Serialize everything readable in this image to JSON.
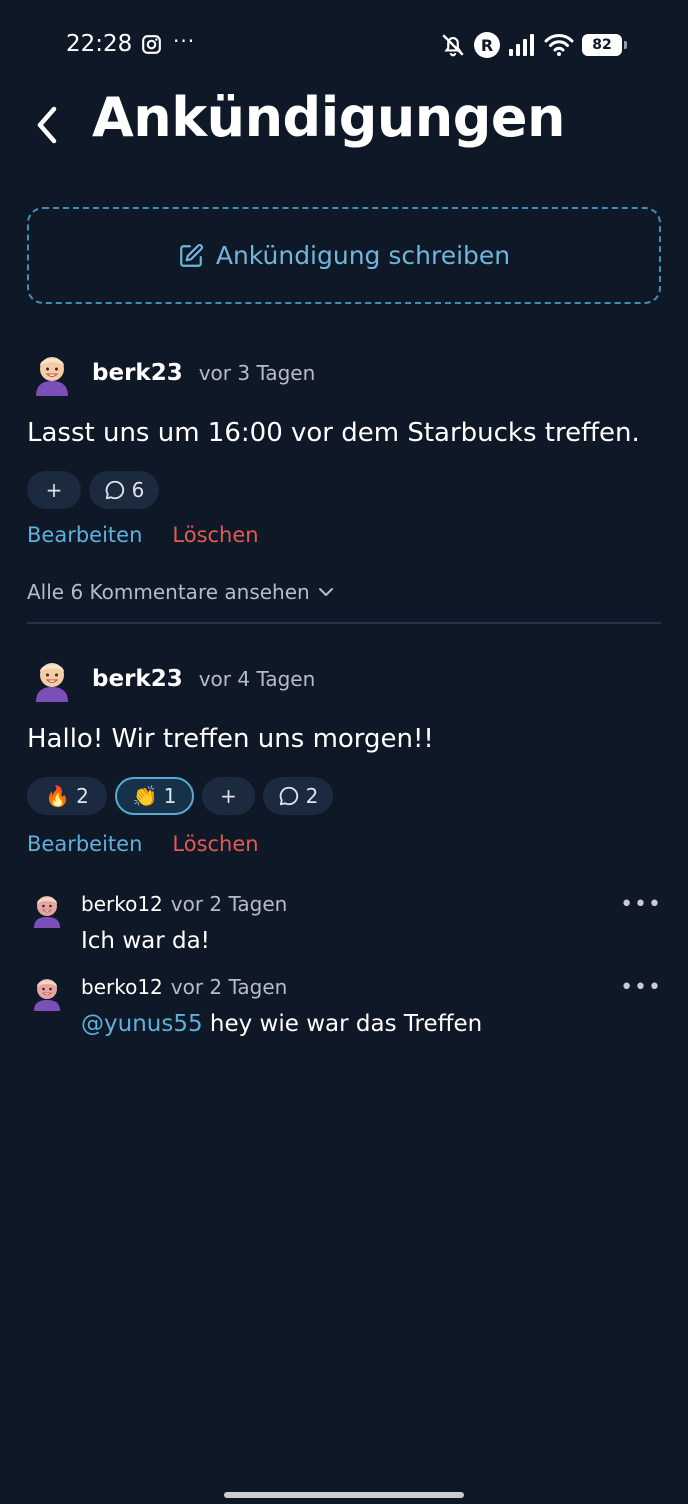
{
  "status_bar": {
    "time": "22:28",
    "more": "···",
    "carrier_badge": "R",
    "battery": "82"
  },
  "header": {
    "title": "Ankündigungen"
  },
  "compose": {
    "label": "Ankündigung schreiben"
  },
  "posts": [
    {
      "user": "berk23",
      "time": "vor 3 Tagen",
      "text": "Lasst uns um 16:00 vor dem Starbucks treffen.",
      "add_reaction": "+",
      "comment_count": "6",
      "edit_label": "Bearbeiten",
      "delete_label": "Löschen",
      "view_all_label": "Alle 6 Kommentare ansehen"
    },
    {
      "user": "berk23",
      "time": "vor 4 Tagen",
      "text": "Hallo! Wir treffen uns morgen!!",
      "reactions": [
        {
          "emoji": "🔥",
          "count": "2",
          "active": false
        },
        {
          "emoji": "👏",
          "count": "1",
          "active": true
        }
      ],
      "add_reaction": "+",
      "comment_count": "2",
      "edit_label": "Bearbeiten",
      "delete_label": "Löschen",
      "comments": [
        {
          "user": "berko12",
          "time": "vor 2 Tagen",
          "mention": "",
          "text": "Ich war da!",
          "more": "•••"
        },
        {
          "user": "berko12",
          "time": "vor 2 Tagen",
          "mention": "@yunus55",
          "text": " hey wie war das Treffen",
          "more": "•••"
        }
      ]
    }
  ],
  "colors": {
    "background": "#0f1826",
    "accent": "#5fb0dc",
    "danger": "#e35a53",
    "chip": "#1b2a3f"
  }
}
